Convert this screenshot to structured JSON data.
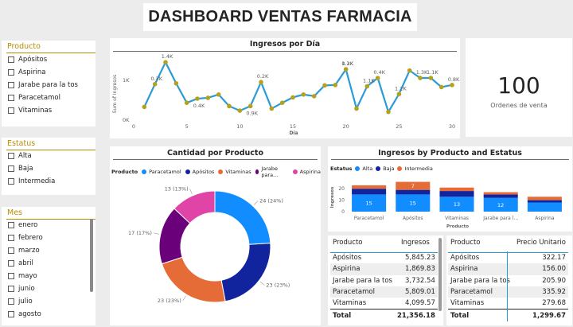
{
  "dashboard_title": "DASHBOARD VENTAS FARMACIA",
  "slicers": {
    "producto": {
      "header": "Producto",
      "options": [
        "Apósitos",
        "Aspirina",
        "Jarabe para la tos",
        "Paracetamol",
        "Vitaminas"
      ]
    },
    "estatus": {
      "header": "Estatus",
      "options": [
        "Alta",
        "Baja",
        "Intermedia"
      ]
    },
    "mes": {
      "header": "Mes",
      "options": [
        "enero",
        "febrero",
        "marzo",
        "abril",
        "mayo",
        "junio",
        "julio",
        "agosto"
      ]
    }
  },
  "card": {
    "value": "100",
    "label": "Ordenes de venta"
  },
  "line_chart": {
    "title": "Ingresos por Día",
    "ylabel": "Sum of Ingresos",
    "xlabel": "Día",
    "y_ticks": [
      "0K",
      "1K"
    ],
    "x_ticks": [
      "0",
      "5",
      "10",
      "15",
      "20",
      "25",
      "30"
    ]
  },
  "donut_chart": {
    "title": "Cantidad por Producto",
    "legend_title": "Producto",
    "legend": [
      "Paracetamol",
      "Apósitos",
      "Vitaminas",
      "Jarabe para...",
      "Aspirina"
    ]
  },
  "stacked_chart": {
    "title": "Ingresos by Producto and Estatus",
    "legend_title": "Estatus",
    "legend": [
      "Alta",
      "Baja",
      "Intermedia"
    ],
    "y_ticks": [
      "0",
      "10",
      "20"
    ],
    "ylabel": "Ingresos",
    "xlabel": "Producto",
    "categories": [
      "Paracetamol",
      "Apósitos",
      "Vitaminas",
      "Jarabe para l...",
      "Aspirina"
    ]
  },
  "table_ingresos": {
    "headers": [
      "Producto",
      "Ingresos"
    ],
    "rows": [
      [
        "Apósitos",
        "5,845.23"
      ],
      [
        "Aspirina",
        "1,869.83"
      ],
      [
        "Jarabe para la tos",
        "3,732.54"
      ],
      [
        "Paracetamol",
        "5,809.01"
      ],
      [
        "Vitaminas",
        "4,099.57"
      ]
    ],
    "total": [
      "Total",
      "21,356.18"
    ]
  },
  "table_precio": {
    "headers": [
      "Producto",
      "Precio Unitario"
    ],
    "rows": [
      [
        "Apósitos",
        "322.17"
      ],
      [
        "Aspirina",
        "156.00"
      ],
      [
        "Jarabe para la tos",
        "205.90"
      ],
      [
        "Paracetamol",
        "335.92"
      ],
      [
        "Vitaminas",
        "279.68"
      ]
    ],
    "total": [
      "Total",
      "1,299.67"
    ]
  },
  "colors": {
    "line": "#2b9bd6",
    "marker": "#b5a11a",
    "paracetamol": "#118dff",
    "apositos": "#12239e",
    "vitaminas": "#e66c37",
    "jarabe": "#6b007b",
    "aspirina": "#e044a7",
    "slicer_accent": "#b58d00"
  },
  "chart_data": [
    {
      "type": "line",
      "title": "Ingresos por Día",
      "xlabel": "Día",
      "ylabel": "Sum of Ingresos",
      "xlim": [
        0,
        30
      ],
      "ylim": [
        0,
        1500
      ],
      "x": [
        1,
        2,
        3,
        4,
        5,
        6,
        7,
        8,
        9,
        10,
        11,
        12,
        13,
        14,
        15,
        16,
        17,
        18,
        19,
        20,
        21,
        22,
        23,
        24,
        25,
        26,
        27,
        28,
        29,
        30
      ],
      "values": [
        300,
        850,
        1380,
        870,
        400,
        500,
        520,
        600,
        320,
        210,
        320,
        900,
        260,
        400,
        530,
        600,
        560,
        820,
        830,
        1210,
        260,
        800,
        1000,
        180,
        610,
        1180,
        1000,
        1000,
        780,
        830
      ],
      "data_labels": [
        {
          "x": 3,
          "label": "1.4K"
        },
        {
          "x": 6,
          "label": "0.4K"
        },
        {
          "x": 2,
          "label": "0.3K"
        },
        {
          "x": 11,
          "label": "0.9K"
        },
        {
          "x": 12,
          "label": "0.2K"
        },
        {
          "x": 20,
          "label": "1.3K"
        },
        {
          "x": 20,
          "label": "0.2K"
        },
        {
          "x": 22,
          "label": "1.1K"
        },
        {
          "x": 23,
          "label": "0.4K"
        },
        {
          "x": 25,
          "label": "1.2K"
        },
        {
          "x": 27,
          "label": "1.3K"
        },
        {
          "x": 28,
          "label": "1.1K"
        },
        {
          "x": 30,
          "label": "0.8K"
        }
      ]
    },
    {
      "type": "pie",
      "title": "Cantidad por Producto",
      "categories": [
        "Paracetamol",
        "Apósitos",
        "Vitaminas",
        "Jarabe para...",
        "Aspirina"
      ],
      "values": [
        24,
        23,
        23,
        17,
        13
      ],
      "labels": [
        "24 (24%)",
        "23 (23%)",
        "23 (23%)",
        "17 (17%)",
        "13 (13%)"
      ]
    },
    {
      "type": "bar",
      "stacked": true,
      "title": "Ingresos by Producto and Estatus",
      "xlabel": "Producto",
      "ylabel": "Ingresos",
      "ylim": [
        0,
        25
      ],
      "categories": [
        "Paracetamol",
        "Apósitos",
        "Vitaminas",
        "Jarabe para l...",
        "Aspirina"
      ],
      "series": [
        {
          "name": "Alta",
          "values": [
            15,
            15,
            13,
            12,
            8
          ]
        },
        {
          "name": "Baja",
          "values": [
            5,
            4,
            5,
            3,
            2
          ]
        },
        {
          "name": "Intermedia",
          "values": [
            3,
            7,
            3,
            2,
            3
          ]
        }
      ],
      "data_labels": [
        [
          "15",
          "15",
          "13",
          "12",
          ""
        ],
        [
          "",
          "",
          "",
          "",
          ""
        ],
        [
          "",
          "7",
          "",
          "",
          ""
        ]
      ]
    }
  ]
}
